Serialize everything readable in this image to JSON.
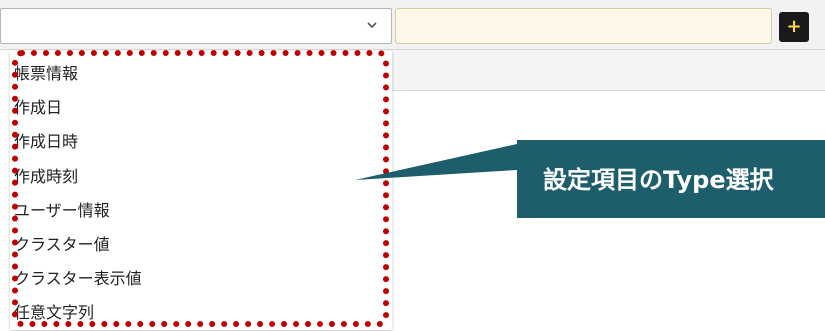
{
  "toolbar": {
    "type_select": {
      "value": "",
      "icon": "chevron-down-icon"
    },
    "text_input": {
      "value": ""
    },
    "add_button": {
      "label": "+",
      "icon": "plus-icon"
    }
  },
  "dropdown": {
    "options": [
      "帳票情報",
      "作成日",
      "作成日時",
      "作成時刻",
      "ユーザー情報",
      "クラスター値",
      "クラスター表示値",
      "任意文字列"
    ]
  },
  "callout": {
    "text": "設定項目のType選択"
  },
  "colors": {
    "highlight": "#c00000",
    "callout_bg": "#1e5d6b",
    "input_bg": "#fff7e8",
    "button_bg": "#1a1a1a",
    "button_fg": "#ffd94a"
  }
}
